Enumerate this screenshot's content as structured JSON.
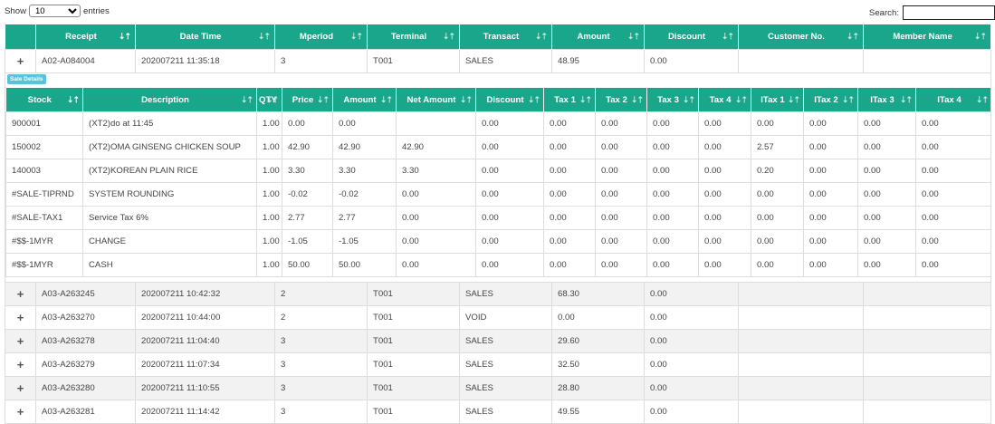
{
  "controls": {
    "show_label": "Show",
    "entries_value": "10",
    "entries_label": "entries",
    "search_label": "Search:",
    "search_value": ""
  },
  "main_columns": [
    "Receipt",
    "Date Time",
    "Mperiod",
    "Terminal",
    "Transact",
    "Amount",
    "Discount",
    "Customer No.",
    "Member Name"
  ],
  "expanded_row": {
    "expander": "+",
    "receipt": "A02-A084004",
    "datetime": "202007211 11:35:18",
    "mperiod": "3",
    "terminal": "T001",
    "transact": "SALES",
    "amount": "48.95",
    "discount": "0.00",
    "customer": "",
    "member": ""
  },
  "sale_details_label": "Sale Details",
  "detail_columns": [
    "Stock",
    "Description",
    "QTY",
    "Price",
    "Amount",
    "Net Amount",
    "Discount",
    "Tax 1",
    "Tax 2",
    "Tax 3",
    "Tax 4",
    "ITax 1",
    "ITax 2",
    "ITax 3",
    "ITax 4"
  ],
  "detail_rows": [
    [
      "900001",
      "(XT2)do at 11:45",
      "1.00",
      "0.00",
      "0.00",
      "",
      "0.00",
      "0.00",
      "0.00",
      "0.00",
      "0.00",
      "0.00",
      "0.00",
      "0.00",
      "0.00"
    ],
    [
      "150002",
      "(XT2)OMA GINSENG CHICKEN SOUP",
      "1.00",
      "42.90",
      "42.90",
      "42.90",
      "0.00",
      "0.00",
      "0.00",
      "0.00",
      "0.00",
      "2.57",
      "0.00",
      "0.00",
      "0.00"
    ],
    [
      "140003",
      "(XT2)KOREAN PLAIN RICE",
      "1.00",
      "3.30",
      "3.30",
      "3.30",
      "0.00",
      "0.00",
      "0.00",
      "0.00",
      "0.00",
      "0.20",
      "0.00",
      "0.00",
      "0.00"
    ],
    [
      "#SALE-TIPRND",
      "SYSTEM ROUNDING",
      "1.00",
      "-0.02",
      "-0.02",
      "0.00",
      "0.00",
      "0.00",
      "0.00",
      "0.00",
      "0.00",
      "0.00",
      "0.00",
      "0.00",
      "0.00"
    ],
    [
      "#SALE-TAX1",
      "Service Tax 6%",
      "1.00",
      "2.77",
      "2.77",
      "0.00",
      "0.00",
      "0.00",
      "0.00",
      "0.00",
      "0.00",
      "0.00",
      "0.00",
      "0.00",
      "0.00"
    ],
    [
      "#$$-1MYR",
      "CHANGE",
      "1.00",
      "-1.05",
      "-1.05",
      "0.00",
      "0.00",
      "0.00",
      "0.00",
      "0.00",
      "0.00",
      "0.00",
      "0.00",
      "0.00",
      "0.00"
    ],
    [
      "#$$-1MYR",
      "CASH",
      "1.00",
      "50.00",
      "50.00",
      "0.00",
      "0.00",
      "0.00",
      "0.00",
      "0.00",
      "0.00",
      "0.00",
      "0.00",
      "0.00",
      "0.00"
    ]
  ],
  "other_rows": [
    {
      "expander": "+",
      "receipt": "A03-A263245",
      "datetime": "202007211 10:42:32",
      "mperiod": "2",
      "terminal": "T001",
      "transact": "SALES",
      "amount": "68.30",
      "discount": "0.00",
      "customer": "",
      "member": ""
    },
    {
      "expander": "+",
      "receipt": "A03-A263270",
      "datetime": "202007211 10:44:00",
      "mperiod": "2",
      "terminal": "T001",
      "transact": "VOID",
      "amount": "0.00",
      "discount": "0.00",
      "customer": "",
      "member": ""
    },
    {
      "expander": "+",
      "receipt": "A03-A263278",
      "datetime": "202007211 11:04:40",
      "mperiod": "3",
      "terminal": "T001",
      "transact": "SALES",
      "amount": "29.60",
      "discount": "0.00",
      "customer": "",
      "member": ""
    },
    {
      "expander": "+",
      "receipt": "A03-A263279",
      "datetime": "202007211 11:07:34",
      "mperiod": "3",
      "terminal": "T001",
      "transact": "SALES",
      "amount": "32.50",
      "discount": "0.00",
      "customer": "",
      "member": ""
    },
    {
      "expander": "+",
      "receipt": "A03-A263280",
      "datetime": "202007211 11:10:55",
      "mperiod": "3",
      "terminal": "T001",
      "transact": "SALES",
      "amount": "28.80",
      "discount": "0.00",
      "customer": "",
      "member": ""
    },
    {
      "expander": "+",
      "receipt": "A03-A263281",
      "datetime": "202007211 11:14:42",
      "mperiod": "3",
      "terminal": "T001",
      "transact": "SALES",
      "amount": "49.55",
      "discount": "0.00",
      "customer": "",
      "member": ""
    }
  ],
  "colors": {
    "header_bg": "#1aa68a",
    "header_text": "#ffffff",
    "sale_details_btn": "#5bc0de",
    "alt_row": "#f2f2f2"
  }
}
